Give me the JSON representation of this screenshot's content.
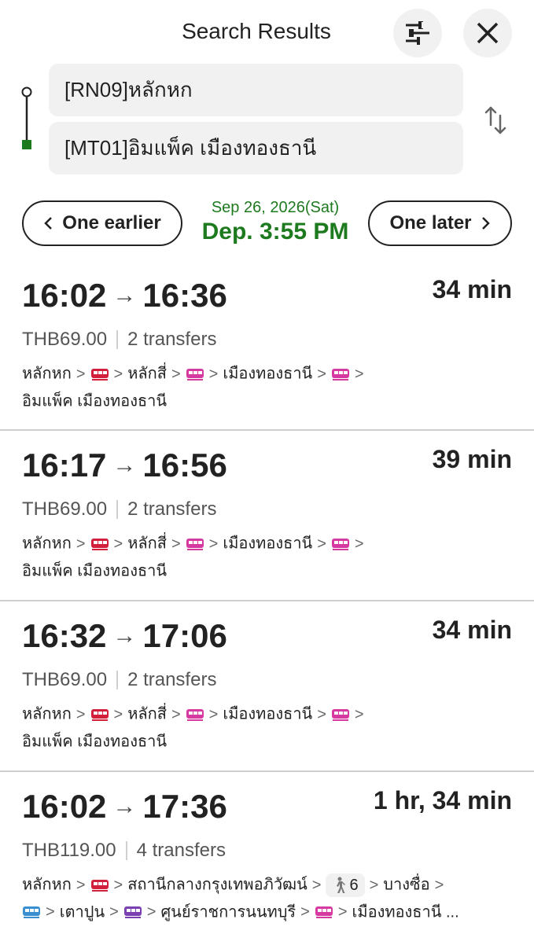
{
  "header": {
    "title": "Search Results"
  },
  "search": {
    "from": "[RN09]หลักหก",
    "to": "[MT01]อิมแพ็ค เมืองทองธานี"
  },
  "nav": {
    "earlier_label": "One earlier",
    "later_label": "One later",
    "date": "Sep 26, 2026(Sat)",
    "departure": "Dep. 3:55 PM"
  },
  "colors": {
    "accent_green": "#1e7a1e",
    "red_line": "#d21f3c",
    "pink_line": "#d63aa0",
    "blue_line": "#3a8fd0",
    "purple_line": "#7a3fb0"
  },
  "results": [
    {
      "dep": "16:02",
      "arr": "16:36",
      "duration": "34 min",
      "fare": "THB69.00",
      "transfers": "2 transfers",
      "stations": [
        "หลักหก",
        "หลักสี่",
        "เมืองทองธานี",
        "อิมแพ็ค เมืองทองธานี"
      ]
    },
    {
      "dep": "16:17",
      "arr": "16:56",
      "duration": "39 min",
      "fare": "THB69.00",
      "transfers": "2 transfers",
      "stations": [
        "หลักหก",
        "หลักสี่",
        "เมืองทองธานี",
        "อิมแพ็ค เมืองทองธานี"
      ]
    },
    {
      "dep": "16:32",
      "arr": "17:06",
      "duration": "34 min",
      "fare": "THB69.00",
      "transfers": "2 transfers",
      "stations": [
        "หลักหก",
        "หลักสี่",
        "เมืองทองธานี",
        "อิมแพ็ค เมืองทองธานี"
      ]
    },
    {
      "dep": "16:02",
      "arr": "17:36",
      "duration": "1 hr, 34 min",
      "fare": "THB119.00",
      "transfers": "4 transfers",
      "stations": [
        "หลักหก",
        "สถานีกลางกรุงเทพอภิวัฒน์",
        "บางซื่อ",
        "เตาปูน",
        "ศูนย์ราชการนนทบุรี",
        "เมืองทองธานี ..."
      ],
      "walk_minutes": "6"
    }
  ]
}
